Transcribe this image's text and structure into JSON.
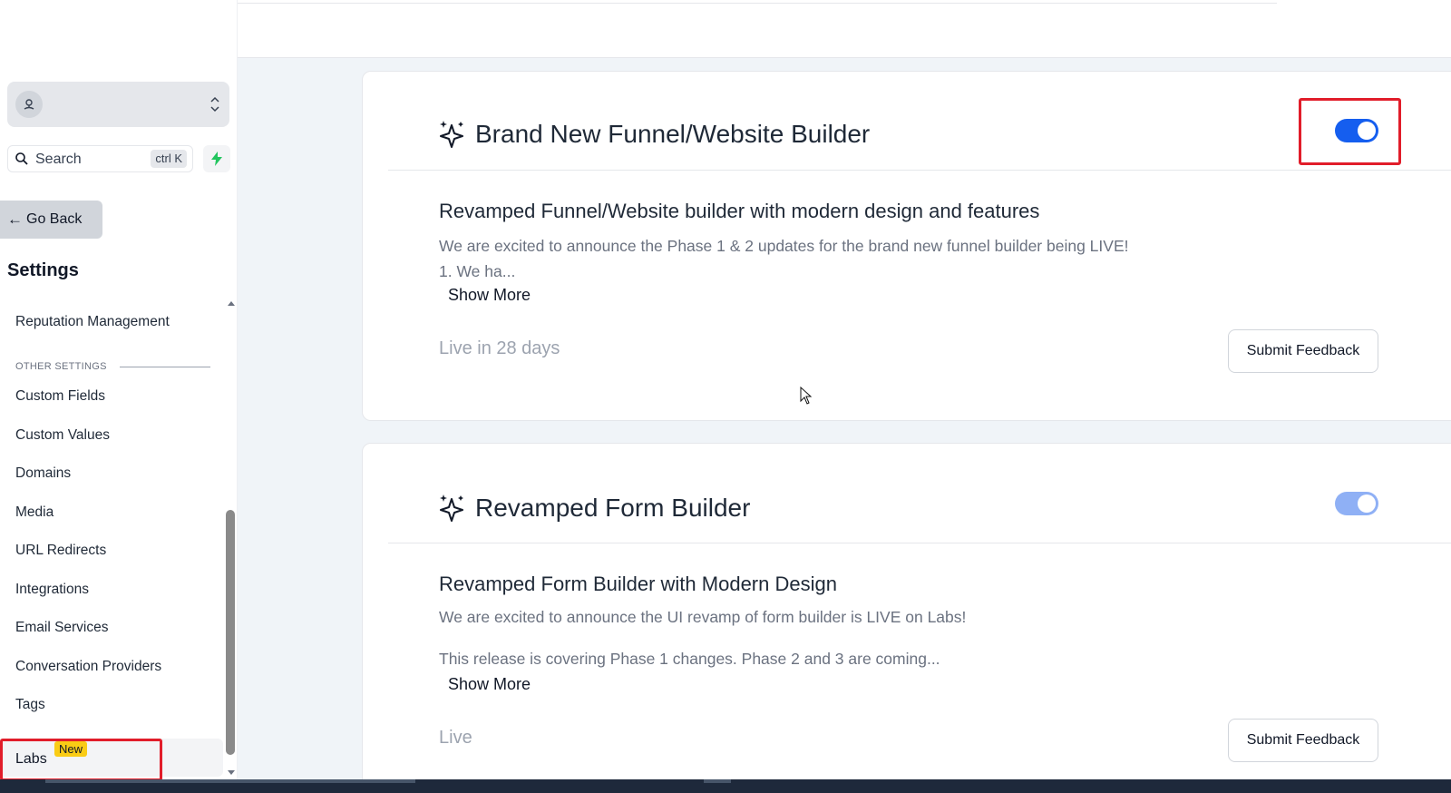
{
  "sidebar": {
    "search": {
      "label": "Search",
      "shortcut": "ctrl K"
    },
    "go_back_label": "Go Back",
    "settings_title": "Settings",
    "items": [
      {
        "label": "Reputation Management"
      },
      {
        "label": "Custom Fields"
      },
      {
        "label": "Custom Values"
      },
      {
        "label": "Domains"
      },
      {
        "label": "Media"
      },
      {
        "label": "URL Redirects"
      },
      {
        "label": "Integrations"
      },
      {
        "label": "Email Services"
      },
      {
        "label": "Conversation Providers"
      },
      {
        "label": "Tags"
      }
    ],
    "section_other": "OTHER SETTINGS",
    "labs": {
      "label": "Labs",
      "badge": "New"
    }
  },
  "cards": [
    {
      "title": "Brand New Funnel/Website Builder",
      "subtitle": "Revamped Funnel/Website builder with modern design and features",
      "description_line1": "We are excited to announce the Phase 1 & 2 updates for the brand new funnel builder being LIVE!",
      "description_line2": "1. We ha...",
      "show_more": "Show More",
      "status": "Live in 28 days",
      "feedback_label": "Submit Feedback",
      "toggle_on": true
    },
    {
      "title": "Revamped Form Builder",
      "subtitle": "Revamped Form Builder with Modern Design",
      "description_line1": "We are excited to announce the UI revamp of form builder is LIVE on Labs!",
      "description_line2": "This release is covering Phase 1 changes. Phase 2 and 3 are coming...",
      "show_more": "Show More",
      "status": "Live",
      "feedback_label": "Submit Feedback",
      "toggle_on": true
    }
  ],
  "colors": {
    "toggle_active": "#155eef",
    "toggle_disabled": "#8fb0f5",
    "highlight": "#e11d2a",
    "badge": "#facc15",
    "quick_action_icon": "#22c55e"
  },
  "icons": {
    "account": "location-pin-icon",
    "switcher": "chevron-up-down-icon",
    "search": "search-icon",
    "quick_action": "lightning-bolt-icon",
    "back": "arrow-left-icon",
    "card": "sparkles-icon"
  }
}
